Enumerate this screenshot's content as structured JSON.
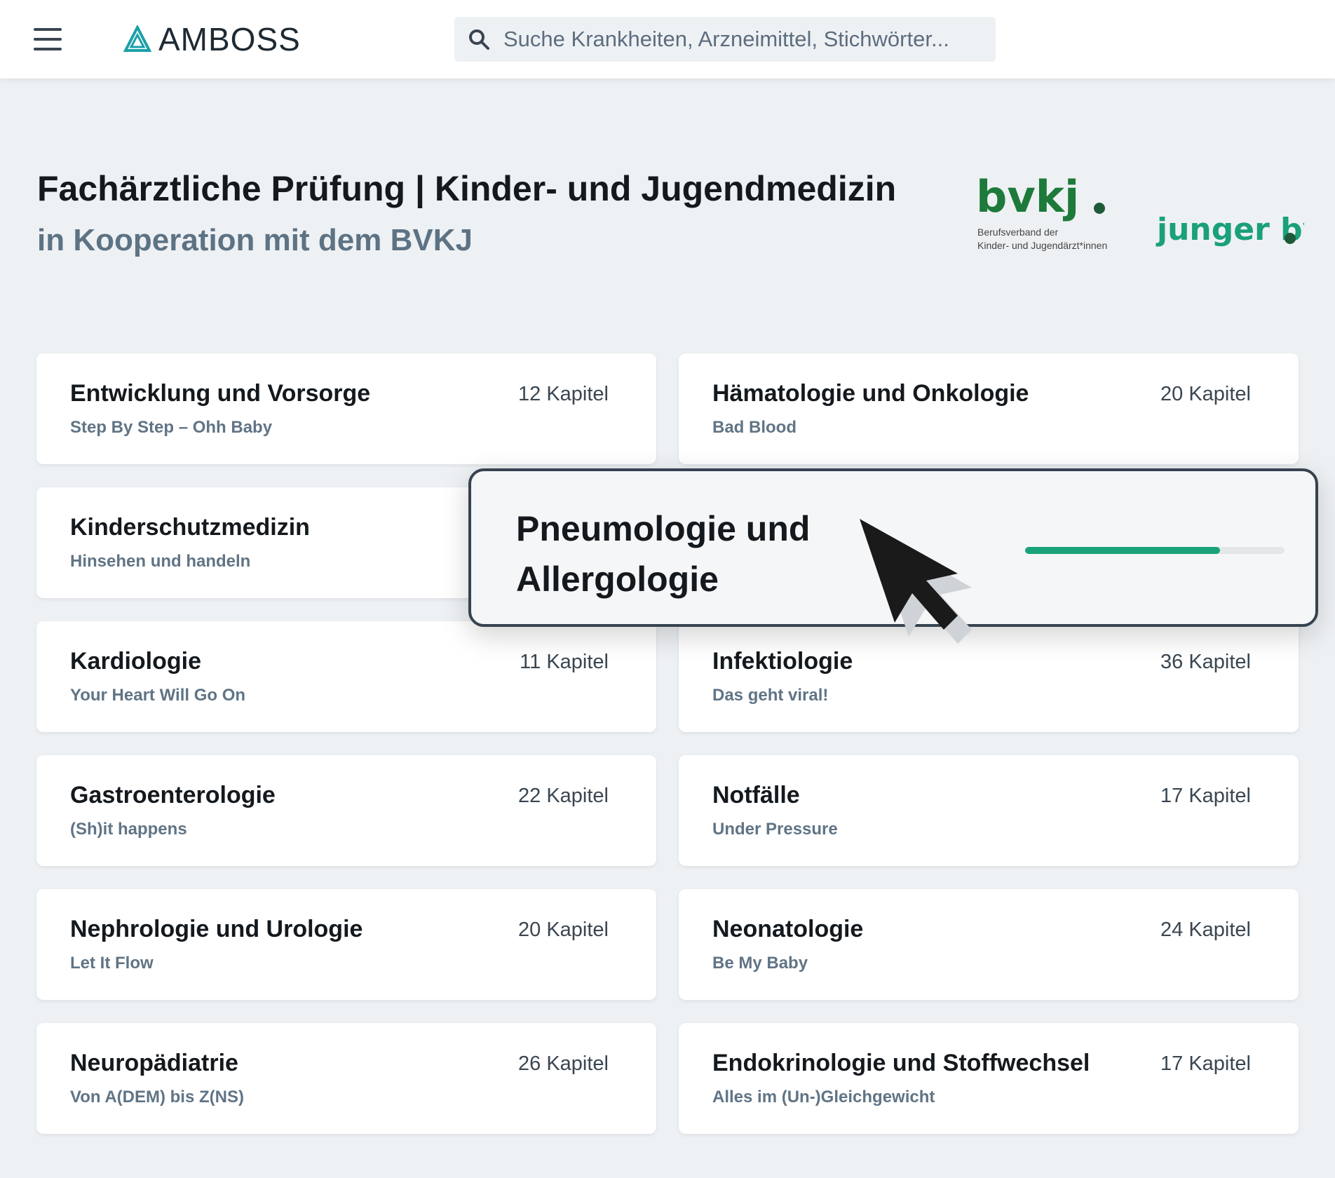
{
  "header": {
    "brand": "AMBOSS",
    "search_placeholder": "Suche Krankheiten, Arzneimittel, Stichwörter..."
  },
  "page": {
    "title": "Fachärztliche Prüfung | Kinder- und Jugendmedizin",
    "subtitle": "in Kooperation mit dem BVKJ"
  },
  "partners": {
    "bvkj_caption_line1": "Berufsverband der",
    "bvkj_caption_line2": "Kinder- und Jugendärzt*innen",
    "bvkj_logo_text": "bvkj",
    "junger_logo_text": "junger bvkj"
  },
  "colors": {
    "accent": "#1aa37a",
    "background": "#eef1f4",
    "subtitle": "#5d7384"
  },
  "cards": [
    {
      "title": "Entwicklung und Vorsorge",
      "subtitle": "Step By Step – Ohh Baby",
      "count": "12 Kapitel"
    },
    {
      "title": "Hämatologie und Onkologie",
      "subtitle": "Bad Blood",
      "count": "20 Kapitel"
    },
    {
      "title": "Kinderschutzmedizin",
      "subtitle": "Hinsehen und handeln",
      "count": ""
    },
    {
      "title": "",
      "subtitle": "",
      "count": ""
    },
    {
      "title": "Kardiologie",
      "subtitle": "Your Heart Will Go On",
      "count": "11 Kapitel"
    },
    {
      "title": "Infektiologie",
      "subtitle": "Das geht viral!",
      "count": "36 Kapitel"
    },
    {
      "title": "Gastroenterologie",
      "subtitle": "(Sh)it happens",
      "count": "22 Kapitel"
    },
    {
      "title": "Notfälle",
      "subtitle": "Under Pressure",
      "count": "17 Kapitel"
    },
    {
      "title": "Nephrologie und Urologie",
      "subtitle": "Let It Flow",
      "count": "20 Kapitel"
    },
    {
      "title": "Neonatologie",
      "subtitle": "Be My Baby",
      "count": "24 Kapitel"
    },
    {
      "title": "Neuropädiatrie",
      "subtitle": "Von A(DEM) bis Z(NS)",
      "count": "26 Kapitel"
    },
    {
      "title": "Endokrinologie und Stoffwechsel",
      "subtitle": "Alles im (Un-)Gleichgewicht",
      "count": "17 Kapitel"
    }
  ],
  "highlight": {
    "title_line1": "Pneumologie und",
    "title_line2": "Allergologie",
    "progress": 0.75
  },
  "icons": {
    "menu": "hamburger-icon",
    "search": "search-icon",
    "cursor": "mouse-pointer-icon"
  }
}
